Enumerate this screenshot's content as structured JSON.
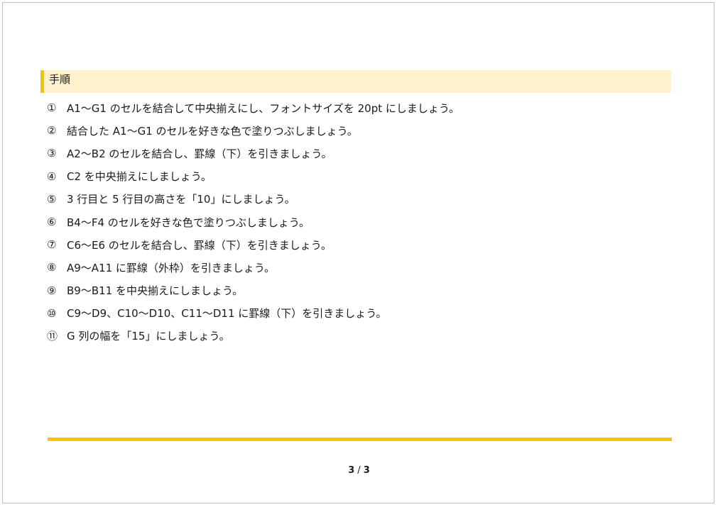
{
  "section": {
    "title": "手順"
  },
  "steps": [
    {
      "num": "①",
      "text": "A1～G1 のセルを結合して中央揃えにし、フォントサイズを 20pt にしましょう。"
    },
    {
      "num": "②",
      "text": "結合した A1～G1 のセルを好きな色で塗りつぶしましょう。"
    },
    {
      "num": "③",
      "text": "A2～B2 のセルを結合し、罫線（下）を引きましょう。"
    },
    {
      "num": "④",
      "text": "C2 を中央揃えにしましょう。"
    },
    {
      "num": "⑤",
      "text": "3 行目と 5 行目の高さを「10」にしましょう。"
    },
    {
      "num": "⑥",
      "text": "B4～F4 のセルを好きな色で塗りつぶしましょう。"
    },
    {
      "num": "⑦",
      "text": "C6～E6 のセルを結合し、罫線（下）を引きましょう。"
    },
    {
      "num": "⑧",
      "text": "A9～A11 に罫線（外枠）を引きましょう。"
    },
    {
      "num": "⑨",
      "text": "B9～B11 を中央揃えにしましょう。"
    },
    {
      "num": "⑩",
      "text": "C9～D9、C10～D10、C11～D11 に罫線（下）を引きましょう。"
    },
    {
      "num": "⑪",
      "text": "G 列の幅を「15」にしましょう。"
    }
  ],
  "footer": {
    "current_page": "3",
    "separator": "/",
    "total_pages": "3"
  },
  "colors": {
    "accent": "#f5c400",
    "header_bg": "#fff1cc"
  }
}
